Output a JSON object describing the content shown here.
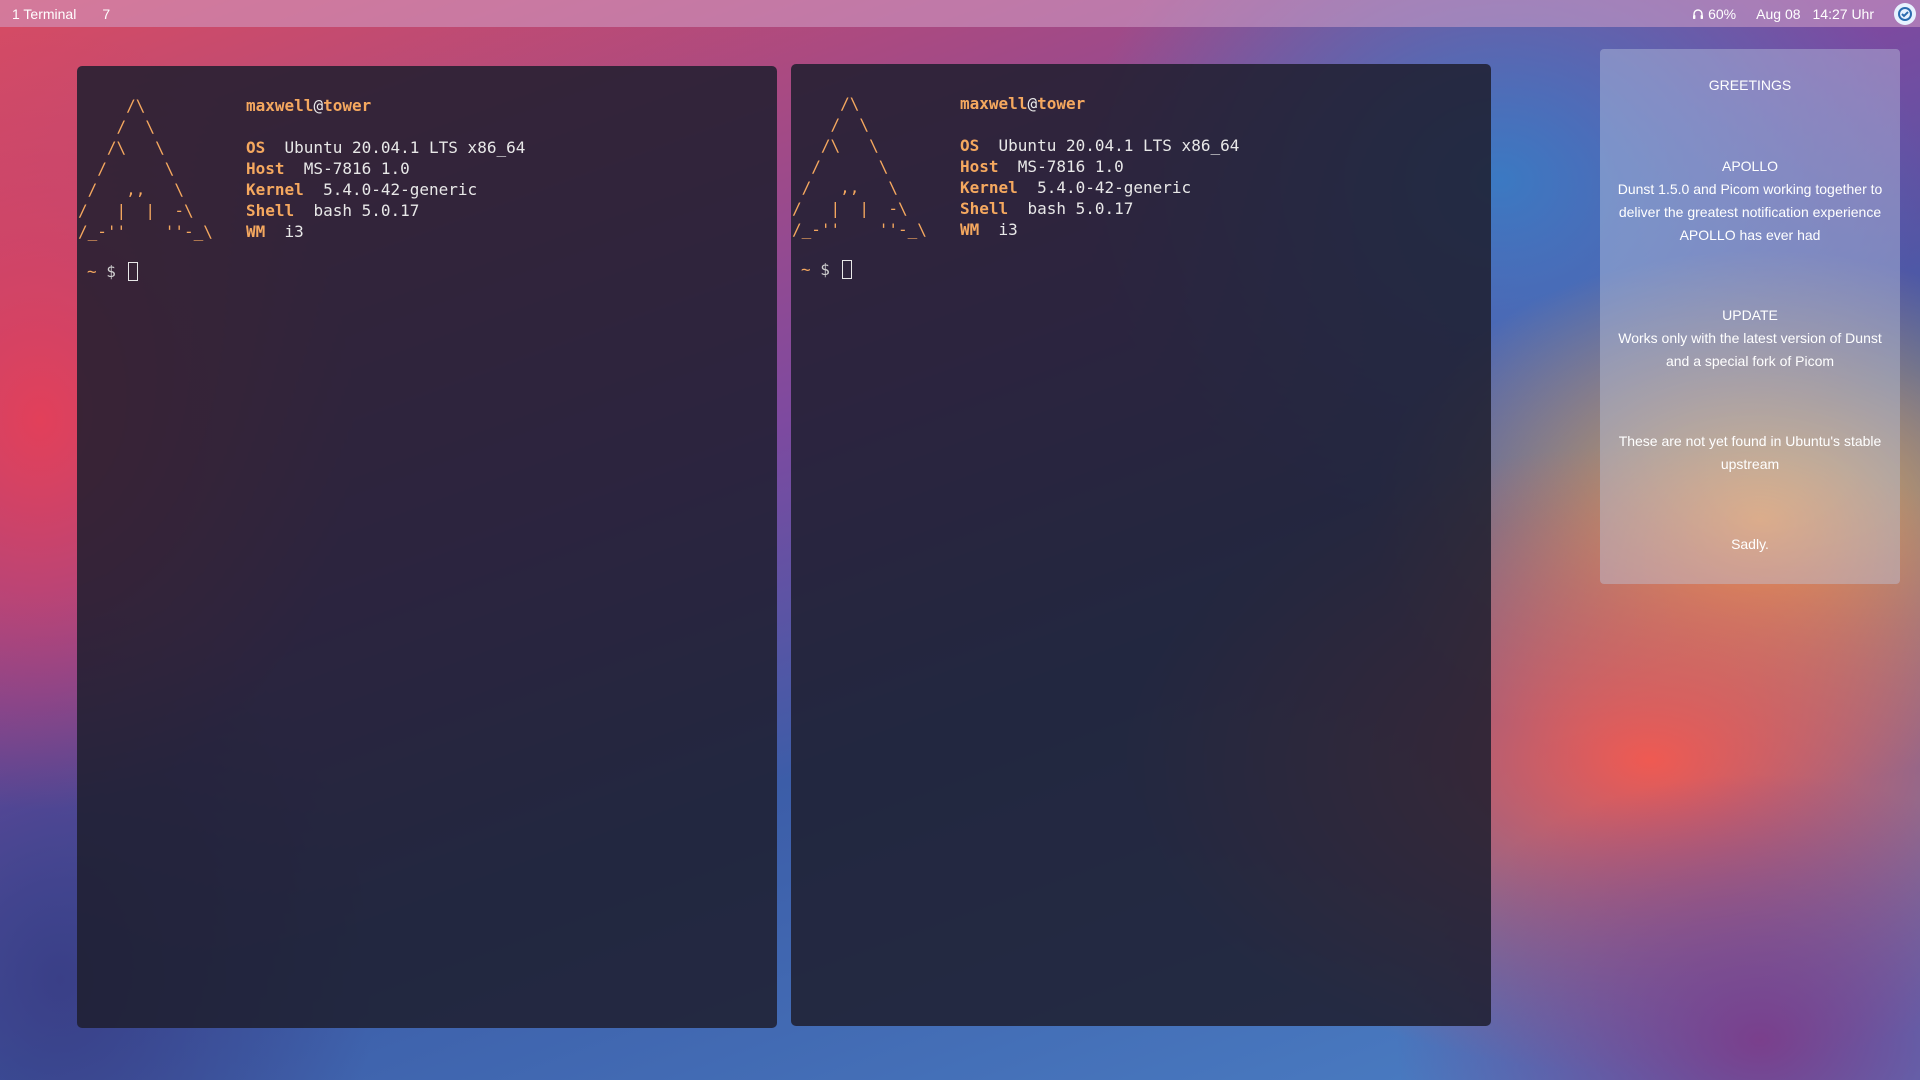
{
  "topbar": {
    "workspaces": [
      {
        "label": "1 Terminal",
        "active": true
      },
      {
        "label": "7",
        "active": false
      }
    ],
    "volume": "60%",
    "date": "Aug 08",
    "time": "14:27 Uhr",
    "icons": {
      "volume": "headphones-icon",
      "tray": "tray-app-icon"
    }
  },
  "terminals": [
    {
      "ascii_logo": "     /\\\n    /  \\\n   /\\   \\\n  /      \\\n /   ,,   \\\n/   |  |  -\\\n/_-''    ''-_\\",
      "user": "maxwell",
      "at": "@",
      "host": "tower",
      "info": [
        {
          "key": "OS",
          "value": "Ubuntu 20.04.1 LTS x86_64"
        },
        {
          "key": "Host",
          "value": "MS-7816 1.0"
        },
        {
          "key": "Kernel",
          "value": "5.4.0-42-generic"
        },
        {
          "key": "Shell",
          "value": "bash 5.0.17"
        },
        {
          "key": "WM",
          "value": "i3"
        }
      ],
      "prompt": {
        "dir": "~",
        "symbol": "$"
      }
    },
    {
      "ascii_logo": "     /\\\n    /  \\\n   /\\   \\\n  /      \\\n /   ,,   \\\n/   |  |  -\\\n/_-''    ''-_\\",
      "user": "maxwell",
      "at": "@",
      "host": "tower",
      "info": [
        {
          "key": "OS",
          "value": "Ubuntu 20.04.1 LTS x86_64"
        },
        {
          "key": "Host",
          "value": "MS-7816 1.0"
        },
        {
          "key": "Kernel",
          "value": "5.4.0-42-generic"
        },
        {
          "key": "Shell",
          "value": "bash 5.0.17"
        },
        {
          "key": "WM",
          "value": "i3"
        }
      ],
      "prompt": {
        "dir": "~",
        "symbol": "$"
      }
    }
  ],
  "notifications": {
    "greeting": "GREETINGS",
    "items": [
      {
        "title": "APOLLO",
        "body": "Dunst 1.5.0 and Picom working together to deliver the greatest notification experience APOLLO has ever had"
      },
      {
        "title": "UPDATE",
        "body": "Works only with the latest version of Dunst and a special fork of Picom"
      },
      {
        "title": "",
        "body": "These are not yet found in Ubuntu's stable upstream"
      },
      {
        "title": "",
        "body": "Sadly."
      }
    ]
  },
  "colors": {
    "accent_orange": "#f5a85f",
    "terminal_bg": "#1e1e2e"
  }
}
